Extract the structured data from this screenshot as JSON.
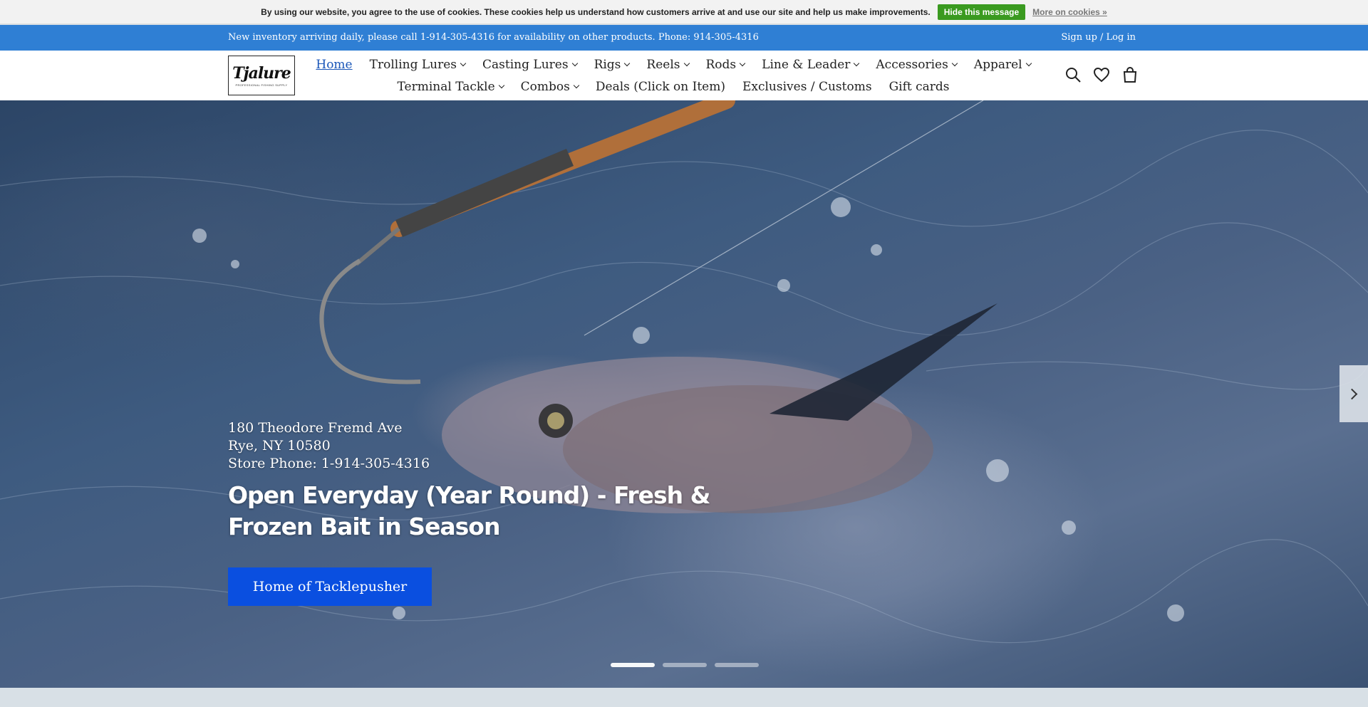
{
  "cookie_bar": {
    "message": "By using our website, you agree to the use of cookies. These cookies help us understand how customers arrive at and use our site and help us make improvements.",
    "hide_label": "Hide this message",
    "more_label": "More on cookies »"
  },
  "notice_bar": {
    "text": "New inventory arriving daily, please call 1-914-305-4316 for availability on other products. Phone: 914-305-4316",
    "account_label": "Sign up / Log in"
  },
  "logo": {
    "word": "Tjalure",
    "sub": "PROFESSIONAL FISHING SUPPLY"
  },
  "nav": {
    "row1": [
      {
        "label": "Home",
        "active": true,
        "dropdown": false
      },
      {
        "label": "Trolling Lures",
        "dropdown": true
      },
      {
        "label": "Casting Lures",
        "dropdown": true
      },
      {
        "label": "Rigs",
        "dropdown": true
      },
      {
        "label": "Reels",
        "dropdown": true
      },
      {
        "label": "Rods",
        "dropdown": true
      },
      {
        "label": "Line & Leader",
        "dropdown": true
      },
      {
        "label": "Accessories",
        "dropdown": true
      },
      {
        "label": "Apparel",
        "dropdown": true
      }
    ],
    "row2": [
      {
        "label": "Terminal Tackle",
        "dropdown": true
      },
      {
        "label": "Combos",
        "dropdown": true
      },
      {
        "label": "Deals (Click on Item)",
        "dropdown": false
      },
      {
        "label": "Exclusives / Customs",
        "dropdown": false
      },
      {
        "label": "Gift cards",
        "dropdown": false
      }
    ]
  },
  "header_icons": [
    "search-icon",
    "heart-icon",
    "shopping-bag-icon"
  ],
  "hero": {
    "address_line1": "180 Theodore Fremd Ave",
    "address_line2": "Rye, NY 10580",
    "phone_line": "Store Phone: 1-914-305-4316",
    "headline": "Open Everyday (Year Round) - Fresh & Frozen Bait in Season",
    "cta_label": "Home of Tacklepusher",
    "slides": 3,
    "active_slide": 1
  },
  "colors": {
    "notice_bar": "#2f7fd4",
    "cta": "#0a4fe0",
    "hide_button": "#3a9a20"
  }
}
